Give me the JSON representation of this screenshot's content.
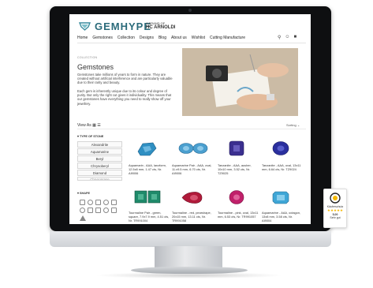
{
  "brand": {
    "name": "GEMHYPE",
    "tagline": "A BRAND OF",
    "company": "HC ARNOLDI"
  },
  "nav": {
    "items": [
      "Home",
      "Gemstones",
      "Collection",
      "Designs",
      "Blog",
      "About us",
      "Wishlist",
      "Cutting Manufacture"
    ]
  },
  "breadcrumb": "COLLECTION",
  "page": {
    "title": "Gemstones",
    "para1": "Gemstones take millions of years to form in nature. They are created without artificial interference and are particularly valuable due to their rarity and beauty.",
    "para2": "Each gem is inherently unique due to its colour and degree of purity. But only the right cut gives it individuality. This means that our gemstones have everything you need to really show off your jewellery."
  },
  "toolbar": {
    "view_as": "View As",
    "sorting": "Sorting"
  },
  "filters": {
    "type_title": "TYPE OF STONE",
    "stones": [
      "Alexandrite",
      "Aquamarine",
      "Beryl",
      "Chrysoberyl",
      "Diamond",
      "Chrysoprase"
    ],
    "shape_title": "SHAPE"
  },
  "products": [
    {
      "caption": "Aquamarin - AAA, lanzform, 12.5x8 mm, 1.47 cts, Nr. AI9006",
      "color": "#2f8fc2"
    },
    {
      "caption": "Aquamarine Pair - AAA, oval, 11.x9.5 mm, 6.70 cts, Nr. AI9006",
      "color": "#4a9fcf"
    },
    {
      "caption": "Tanzanite - AAA, ausher, 10x10 mm, 3.52 cts, Nr. TZ9025",
      "color": "#3b2f8f"
    },
    {
      "caption": "Tanzanite - AAA, oval, 13x11 mm, 6.64 cts, Nr. TZ9024",
      "color": "#2a2f9e"
    },
    {
      "caption": "Tourmaline Pair - green, square, 7.9x7.9 mm, 4.51 cts, Nr. TR991004",
      "color": "#1f8a6a"
    },
    {
      "caption": "Tourmaline - red, pearshape, 20x15 mm, 13.11 cts, Nr. TR991058",
      "color": "#b01a3a"
    },
    {
      "caption": "Tourmaline - pink, oval, 13x11 mm, 6.53 cts, Nr. TR991057",
      "color": "#c0206a"
    },
    {
      "caption": "Aquamarine - AAA, octagon, 13x8 mm, 3.58 cts, Nr. AI9004",
      "color": "#3fa6d6"
    }
  ],
  "trust": {
    "label": "Käuferschutz",
    "score": "5,00",
    "rating": "Sehr gut"
  }
}
